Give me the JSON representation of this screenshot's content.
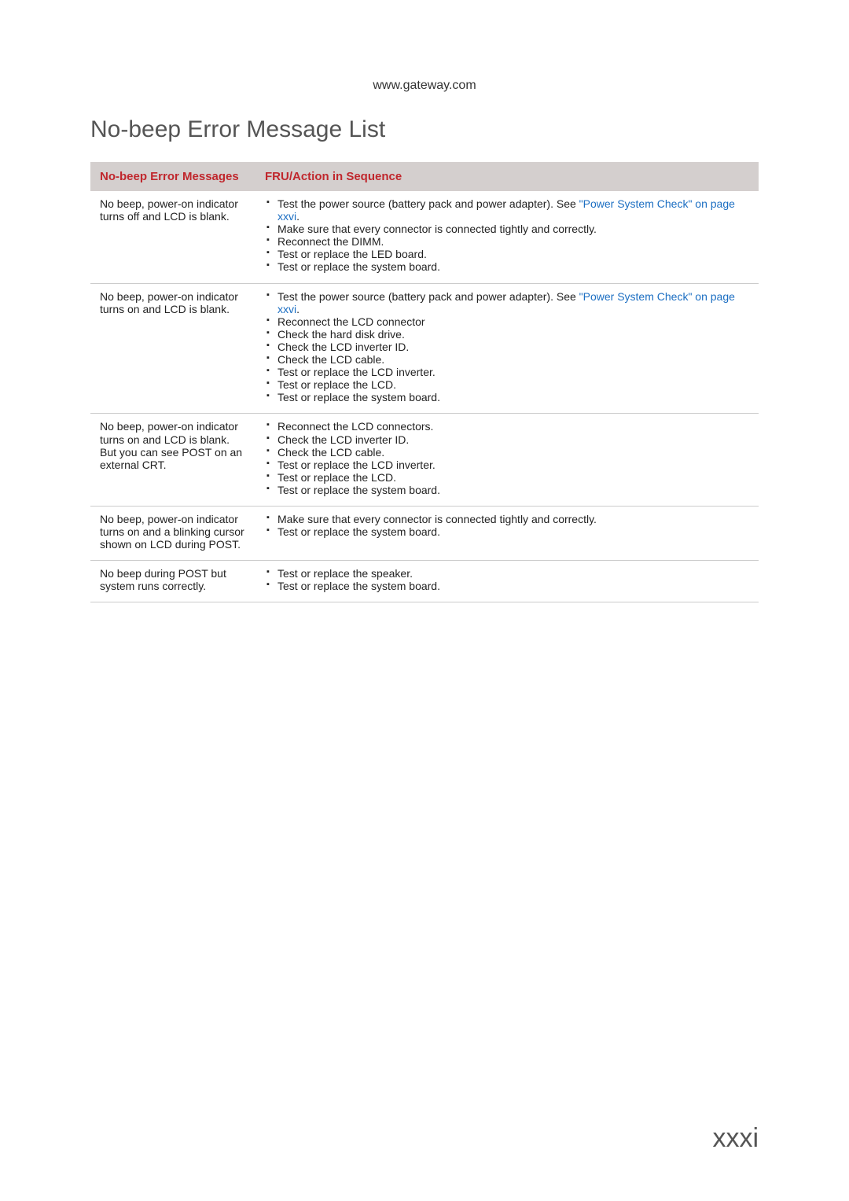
{
  "header_url": "www.gateway.com",
  "main_title": "No-beep Error Message List",
  "table": {
    "headers": {
      "col1": "No-beep Error Messages",
      "col2": "FRU/Action in Sequence"
    },
    "rows": [
      {
        "label": "No beep, power-on indicator turns off and LCD is blank.",
        "items": [
          {
            "pre": "Test the power source (battery pack and power adapter). See ",
            "link": "\"Power System Check\" on page xxvi",
            "post": "."
          },
          {
            "text": "Make sure that every connector is connected tightly and correctly."
          },
          {
            "text": "Reconnect the DIMM."
          },
          {
            "text": "Test or replace the LED board."
          },
          {
            "text": "Test or replace the system board."
          }
        ]
      },
      {
        "label": "No beep, power-on indicator turns on and LCD is blank.",
        "items": [
          {
            "pre": "Test the power source (battery pack and power adapter). See ",
            "link": "\"Power System Check\" on page xxvi",
            "post": "."
          },
          {
            "text": "Reconnect the LCD connector"
          },
          {
            "text": "Check the hard disk drive."
          },
          {
            "text": "Check the LCD inverter ID."
          },
          {
            "text": "Check the LCD cable."
          },
          {
            "text": "Test or replace the LCD inverter."
          },
          {
            "text": "Test or replace the LCD."
          },
          {
            "text": "Test or replace the system board."
          }
        ]
      },
      {
        "label": "No beep, power-on indicator turns on and LCD is blank. But you can see POST on an external CRT.",
        "items": [
          {
            "text": "Reconnect the LCD connectors."
          },
          {
            "text": "Check the LCD inverter ID."
          },
          {
            "text": "Check the LCD cable."
          },
          {
            "text": "Test or replace the LCD inverter."
          },
          {
            "text": "Test or replace the LCD."
          },
          {
            "text": "Test or replace the system board."
          }
        ]
      },
      {
        "label": "No beep, power-on indicator turns on and a blinking cursor shown on LCD during POST.",
        "items": [
          {
            "text": "Make sure that every connector is connected tightly and correctly."
          },
          {
            "text": "Test or replace the system board."
          }
        ]
      },
      {
        "label": "No beep during POST but system runs correctly.",
        "items": [
          {
            "text": "Test or replace the speaker."
          },
          {
            "text": "Test or replace the system board."
          }
        ]
      }
    ]
  },
  "page_number": "xxxi"
}
